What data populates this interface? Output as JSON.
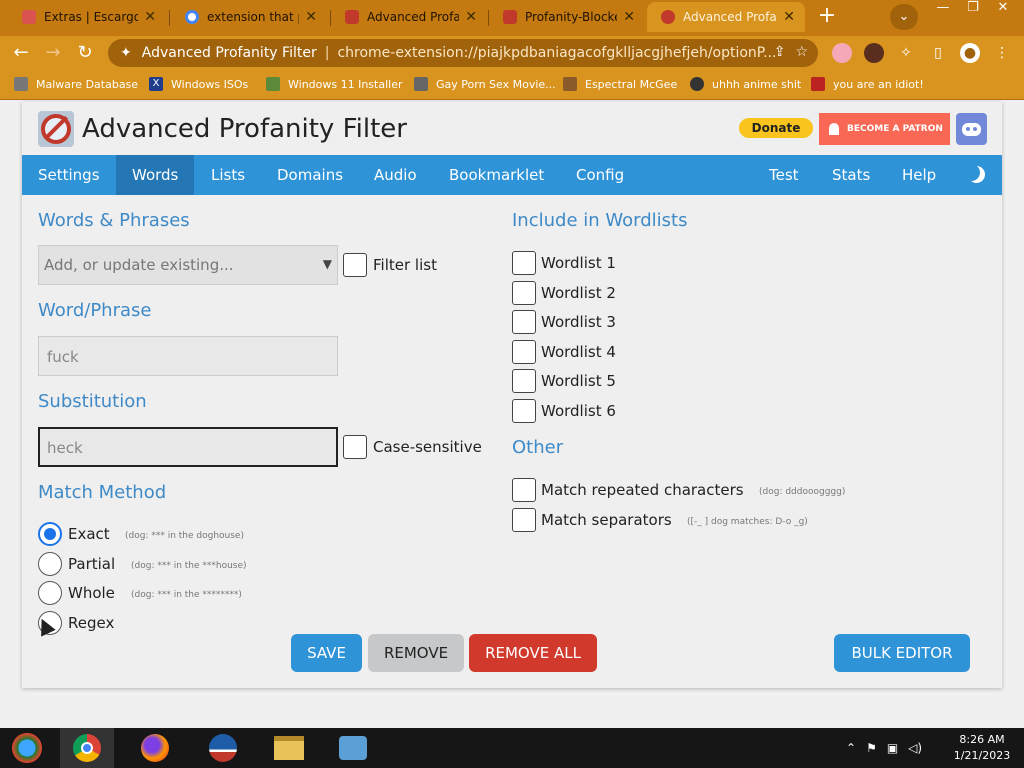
{
  "browser": {
    "tabs": [
      {
        "title": "Extras | Escargot",
        "favicon_color": "#d9534f"
      },
      {
        "title": "extension that put",
        "favicon_color": "#4285f4"
      },
      {
        "title": "Advanced Profanity",
        "favicon_color": "#c0392b"
      },
      {
        "title": "Profanity-Blocker",
        "favicon_color": "#c0392b"
      },
      {
        "title": "Advanced Profanity",
        "favicon_color": "#c0392b"
      }
    ],
    "omnibox": {
      "site": "Advanced Profanity Filter",
      "separator": "|",
      "url": "chrome-extension://piajkpdbaniagacofgklljacgjhefjeh/optionP..."
    },
    "bookmarks": [
      {
        "label": "Malware Database",
        "color": "#555"
      },
      {
        "label": "Windows ISOs",
        "color": "#1e3c8c"
      },
      {
        "label": "Windows 11 Installer",
        "color": "#5a8a3a"
      },
      {
        "label": "Gay Porn Sex Movie...",
        "color": "#666"
      },
      {
        "label": "Espectral McGee",
        "color": "#8a5a2a"
      },
      {
        "label": "uhhh anime shit",
        "color": "#333"
      },
      {
        "label": "you are an idiot!",
        "color": "#b22"
      }
    ]
  },
  "app": {
    "title": "Advanced Profanity Filter",
    "donate_label": "Donate",
    "patron_label": "BECOME A PATRON",
    "nav": [
      {
        "label": "Settings",
        "active": false
      },
      {
        "label": "Words",
        "active": true
      },
      {
        "label": "Lists",
        "active": false
      },
      {
        "label": "Domains",
        "active": false
      },
      {
        "label": "Audio",
        "active": false
      },
      {
        "label": "Bookmarklet",
        "active": false
      },
      {
        "label": "Config",
        "active": false
      }
    ],
    "nav_right": [
      {
        "label": "Test"
      },
      {
        "label": "Stats"
      },
      {
        "label": "Help"
      }
    ],
    "colors": {
      "accent": "#2f93d8",
      "heading": "#3e8ac8",
      "danger": "#c0392b"
    }
  },
  "words": {
    "section_title": "Words & Phrases",
    "select_placeholder": "Add, or update existing...",
    "filter_list_label": "Filter list",
    "word_title": "Word/Phrase",
    "word_value": "fuck",
    "substitution_title": "Substitution",
    "substitution_value": "heck",
    "case_sensitive_label": "Case-sensitive",
    "match_title": "Match Method",
    "match_options": [
      {
        "label": "Exact",
        "hint": "(dog: *** in the doghouse)",
        "selected": true
      },
      {
        "label": "Partial",
        "hint": "(dog: *** in the ***house)",
        "selected": false
      },
      {
        "label": "Whole",
        "hint": "(dog: *** in the ********)",
        "selected": false
      },
      {
        "label": "Regex",
        "hint": "",
        "selected": false
      }
    ]
  },
  "wordlists": {
    "title": "Include in Wordlists",
    "items": [
      "Wordlist 1",
      "Wordlist 2",
      "Wordlist 3",
      "Wordlist 4",
      "Wordlist 5",
      "Wordlist 6"
    ]
  },
  "other": {
    "title": "Other",
    "items": [
      {
        "label": "Match repeated characters",
        "hint": "(dog: dddooogggg)"
      },
      {
        "label": "Match separators",
        "hint": "([-_ ] dog matches: D-o _g)"
      }
    ]
  },
  "actions": {
    "save": "SAVE",
    "remove": "REMOVE",
    "remove_all": "REMOVE ALL",
    "bulk_editor": "BULK EDITOR"
  },
  "taskbar": {
    "time": "8:26 AM",
    "date": "1/21/2023"
  }
}
